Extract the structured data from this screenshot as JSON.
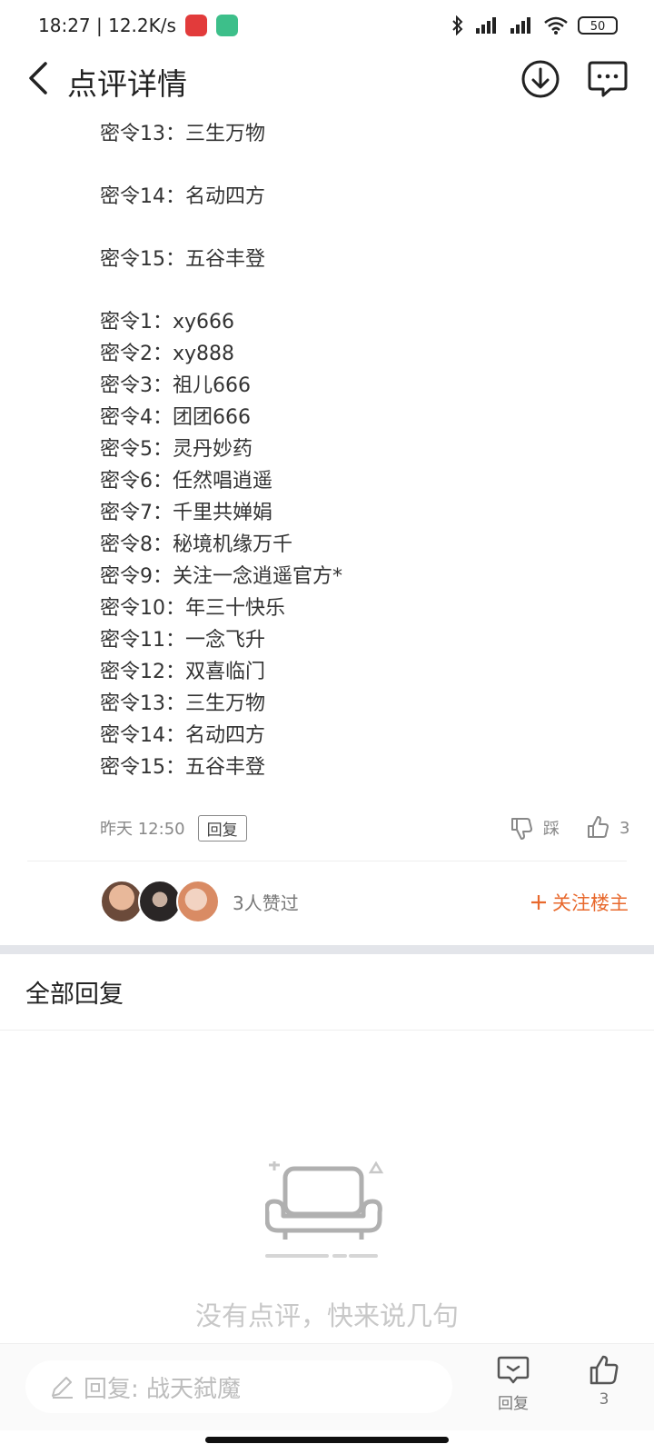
{
  "status_bar": {
    "time_speed": "18:27 | 12.2K/s",
    "battery": "50"
  },
  "header": {
    "title": "点评详情"
  },
  "post": {
    "lines_top": [
      "密令13：三生万物",
      "密令14：名动四方",
      "密令15：五谷丰登"
    ],
    "lines_list": [
      "密令1：xy666",
      "密令2：xy888",
      "密令3：祖儿666",
      "密令4：团团666",
      "密令5：灵丹妙药",
      "密令6：任然唱逍遥",
      "密令7：千里共婵娟",
      "密令8：秘境机缘万千",
      "密令9：关注一念逍遥官方*",
      "密令10：年三十快乐",
      "密令11：一念飞升",
      "密令12：双喜临门",
      "密令13：三生万物",
      "密令14：名动四方",
      "密令15：五谷丰登"
    ],
    "time": "昨天 12:50",
    "reply_label": "回复",
    "dislike_label": "踩",
    "like_count": "3"
  },
  "likers": {
    "text": "3人赞过",
    "follow_label": "关注楼主"
  },
  "replies": {
    "section_title": "全部回复",
    "empty_text": "没有点评，快来说几句"
  },
  "bottom_bar": {
    "placeholder": "回复: 战天弑魔",
    "reply_label": "回复",
    "like_count": "3"
  },
  "colors": {
    "accent": "#e8692d",
    "divider": "#e3e5ea"
  }
}
